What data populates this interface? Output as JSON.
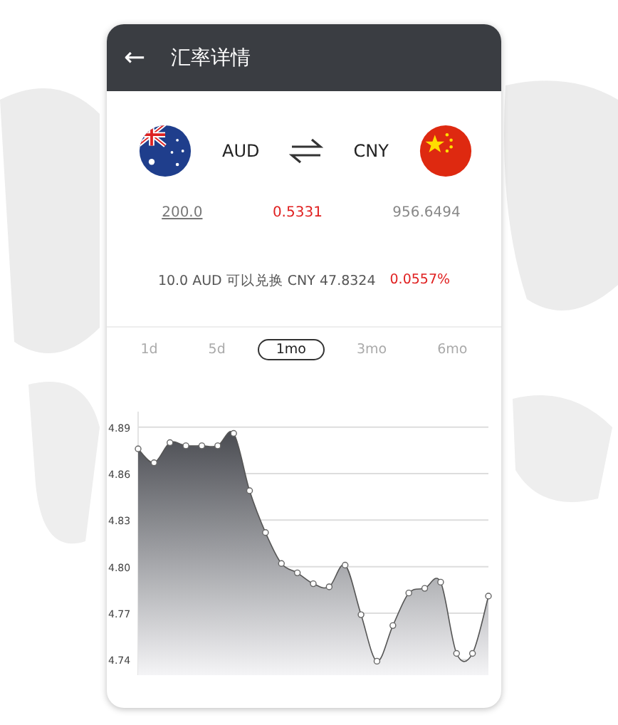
{
  "header": {
    "back_icon": "←",
    "title": "汇率详情"
  },
  "currencies": {
    "from": "AUD",
    "to": "CNY"
  },
  "amounts": {
    "from_amount": "200.0",
    "rate": "0.5331",
    "to_amount": "956.6494"
  },
  "conversion": {
    "text": "10.0 AUD 可以兑换 CNY 47.8324",
    "change": "0.0557%"
  },
  "ranges": [
    {
      "label": "1d",
      "selected": false
    },
    {
      "label": "5d",
      "selected": false
    },
    {
      "label": "1mo",
      "selected": true
    },
    {
      "label": "3mo",
      "selected": false
    },
    {
      "label": "6mo",
      "selected": false
    }
  ],
  "chart_data": {
    "type": "area",
    "grid": true,
    "ylim": [
      4.73,
      4.9
    ],
    "yticks": [
      {
        "value": 4.74,
        "label": "4.74"
      },
      {
        "value": 4.77,
        "label": "4.77"
      },
      {
        "value": 4.8,
        "label": "4.80"
      },
      {
        "value": 4.83,
        "label": "4.83"
      },
      {
        "value": 4.86,
        "label": "4.86"
      },
      {
        "value": 4.89,
        "label": "4.89"
      }
    ],
    "series": [
      {
        "color": "#4a4c52",
        "values": [
          4.876,
          4.867,
          4.88,
          4.878,
          4.878,
          4.878,
          4.886,
          4.849,
          4.822,
          4.802,
          4.796,
          4.789,
          4.787,
          4.801,
          4.769,
          4.739,
          4.762,
          4.783,
          4.786,
          4.79,
          4.744,
          4.744,
          4.781
        ]
      }
    ]
  }
}
